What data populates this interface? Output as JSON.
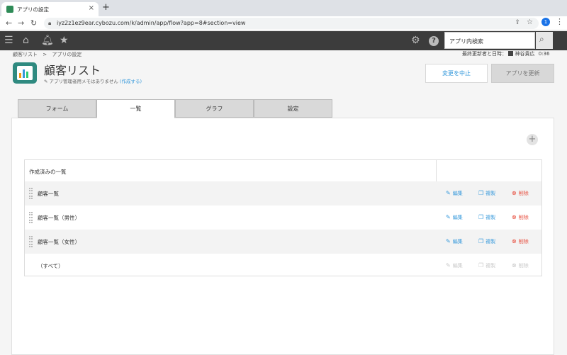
{
  "browser": {
    "tab_title": "アプリの設定",
    "url": "iyz2z1ez9ear.cybozu.com/k/admin/app/flow?app=8#section=view",
    "profile_initial": "1"
  },
  "header": {
    "search_placeholder": "アプリ内検索"
  },
  "breadcrumb": {
    "parent": "顧客リスト",
    "separator": ">",
    "current": "アプリの設定"
  },
  "updater": {
    "label": "最終更新者と日時：",
    "name": "神谷貴広",
    "time": "0:36"
  },
  "app": {
    "title": "顧客リスト",
    "memo": "アプリ管理者用メモはありません",
    "memo_link": "(作成する)"
  },
  "buttons": {
    "cancel": "変更を中止",
    "update": "アプリを更新"
  },
  "tabs": [
    {
      "label": "フォーム",
      "active": false
    },
    {
      "label": "一覧",
      "active": true
    },
    {
      "label": "グラフ",
      "active": false
    },
    {
      "label": "設定",
      "active": false
    }
  ],
  "views": {
    "header": "作成済みの一覧",
    "actions": {
      "edit": "編集",
      "copy": "複製",
      "delete": "削除"
    },
    "rows": [
      {
        "name": "顧客一覧",
        "enabled": true
      },
      {
        "name": "顧客一覧（男性）",
        "enabled": true
      },
      {
        "name": "顧客一覧（女性）",
        "enabled": true
      },
      {
        "name": "（すべて）",
        "enabled": false
      }
    ]
  }
}
